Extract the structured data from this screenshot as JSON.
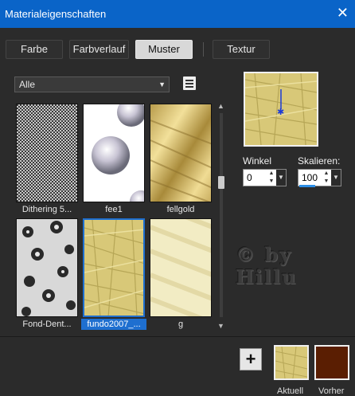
{
  "window": {
    "title": "Materialeigenschaften"
  },
  "tabs": [
    {
      "label": "Farbe",
      "active": false
    },
    {
      "label": "Farbverlauf",
      "active": false
    },
    {
      "label": "Muster",
      "active": true
    },
    {
      "label": "Textur",
      "active": false
    }
  ],
  "category": {
    "selected": "Alle"
  },
  "patterns": [
    {
      "name": "Dithering 5...",
      "selected": false
    },
    {
      "name": "fee1",
      "selected": false
    },
    {
      "name": "fellgold",
      "selected": false
    },
    {
      "name": "Fond-Dent...",
      "selected": false
    },
    {
      "name": "fundo2007_...",
      "selected": true
    },
    {
      "name": "g",
      "selected": false
    }
  ],
  "angle": {
    "label": "Winkel",
    "value": "0"
  },
  "scale": {
    "label": "Skalieren:",
    "value": "100"
  },
  "watermark": {
    "line1": "© by",
    "line2": "Hillu"
  },
  "swatches": {
    "current_label": "Aktuell",
    "previous_label": "Vorher",
    "previous_color": "#5a1e02"
  },
  "colors": {
    "accent": "#0a64c8",
    "selection": "#1e6fd0"
  },
  "icons": {
    "close": "close-icon",
    "add": "plus-icon",
    "list": "document-list-icon"
  }
}
